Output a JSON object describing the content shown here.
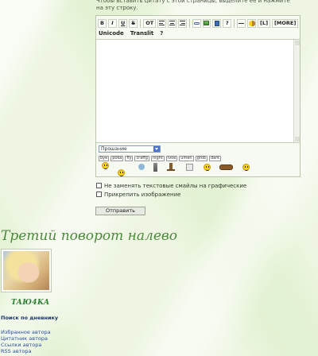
{
  "quote_hint": "Чтобы вставить цитату с этой страницы, выделите ее и нажмите на эту строку.",
  "toolbar": {
    "bold": "B",
    "italic": "I",
    "underline": "U",
    "strike": "S",
    "offtopic": "OT",
    "link_short": "[L]",
    "more": "[MORE]",
    "help": "?"
  },
  "toolbar2": {
    "unicode": "Unicode",
    "translit": "Translit",
    "help": "?"
  },
  "smileys": {
    "select_value": "Прошание",
    "tags": [
      "bye",
      "poka",
      "fly",
      "craffg",
      "night",
      "ivoe",
      "umen",
      "grob",
      "dark"
    ]
  },
  "options": {
    "no_replace_smileys": "Не заменять текстовые смайлы на графические",
    "attach_image": "Прикрепить изображение"
  },
  "submit_label": "Отправить",
  "diary_title": "Третий поворот налево",
  "username": "TAЮ4KA",
  "search_link": "Поиск по дневнику",
  "author_links": [
    "Избранное автора",
    "Цитатник автора",
    "Ссылки автора",
    "RSS автора"
  ],
  "colors": {
    "title_green": "#4b8a3b",
    "link_blue": "#2b4fa0",
    "smiley_yellow": "#f6d21b"
  }
}
